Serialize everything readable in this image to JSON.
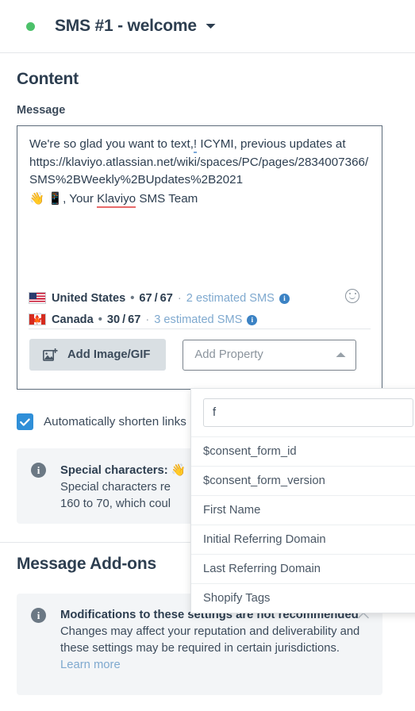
{
  "header": {
    "title": "SMS #1 - welcome",
    "status_color": "#4cc16a",
    "caret": "▾"
  },
  "content": {
    "section_title": "Content",
    "message_label": "Message",
    "message_body": {
      "line1_a": "We're so glad you want to text,",
      "line1_err": "!",
      "line1_b": " ICYMI, previous updates at",
      "line2": "https://klaviyo.atlassian.net/wiki/spaces/PC/pages/2834007366/SMS%2BWeekly%2BUpdates%2B2021",
      "line3_emoji1": "👋",
      "line3_emoji2": "📱",
      "line3_a": ", Your ",
      "line3_err": "Klaviyo",
      "line3_b": " SMS Team"
    },
    "counters": [
      {
        "flag": "us-flag-icon",
        "country": "United States",
        "sep": "•",
        "used": "67",
        "slash": "/",
        "limit": "67",
        "dot": "·",
        "estimate": "2 estimated SMS",
        "info": "i"
      },
      {
        "flag": "canada-flag-icon",
        "country": "Canada",
        "sep": "•",
        "used": "30",
        "slash": "/",
        "limit": "67",
        "dot": "·",
        "estimate": "3 estimated SMS",
        "info": "i"
      }
    ],
    "toolbar": {
      "add_image_label": "Add Image/GIF",
      "add_property_placeholder": "Add Property"
    },
    "shorten_links_label": "Automatically shorten links"
  },
  "special_characters_callout": {
    "icon": "i",
    "heading_a": "Special characters: ",
    "heading_emoji": "👋",
    "body_line1": "Special characters re",
    "body_line2": "160 to 70, which coul"
  },
  "add_ons": {
    "section_title": "Message Add-ons",
    "callout": {
      "icon": "i",
      "heading": "Modifications to these settings are not recommended",
      "body": "Changes may affect your reputation and deliverability and these settings may be required in certain jurisdictions. ",
      "link": "Learn more"
    }
  },
  "property_dropdown": {
    "search_value": "f",
    "items": [
      "$consent_form_id",
      "$consent_form_version",
      "First Name",
      "Initial Referring Domain",
      "Last Referring Domain",
      "Shopify Tags"
    ]
  },
  "colors": {
    "accent_blue": "#2f8fd8",
    "muted_blue": "#7fa9cf",
    "status_green": "#4cc16a",
    "text_dark": "#2d3e50",
    "panel_bg": "#f3f5f7"
  }
}
